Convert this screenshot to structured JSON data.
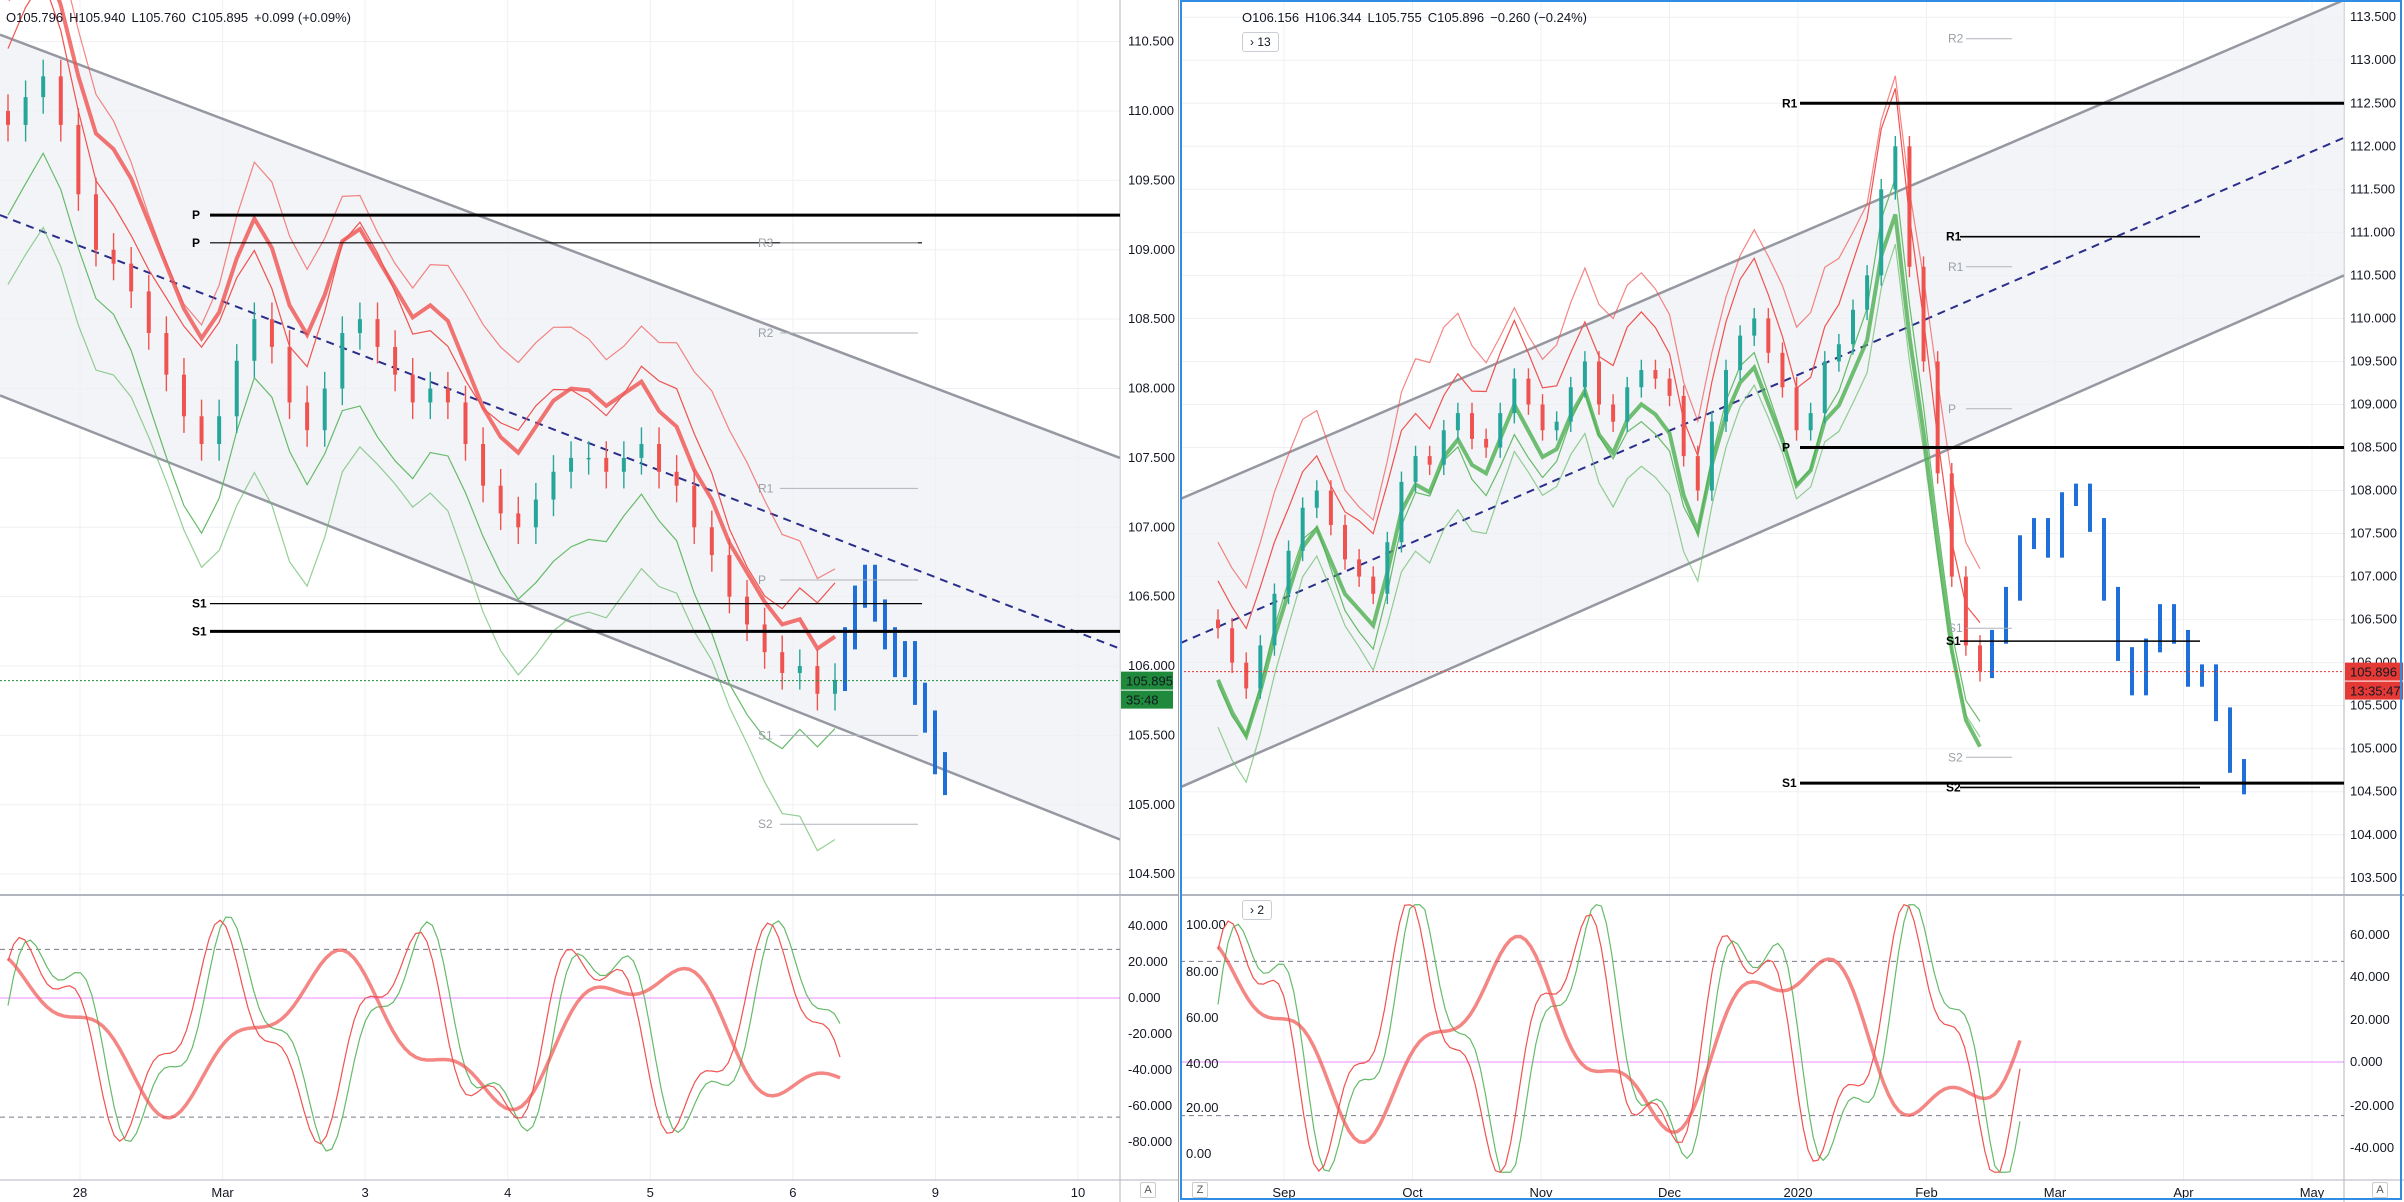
{
  "left": {
    "ohlc": {
      "o": "O105.796",
      "h": "H105.940",
      "l": "L105.760",
      "c": "C105.895",
      "chg": "+0.099 (+0.09%)"
    },
    "price_ticks": [
      "110.500",
      "110.000",
      "109.500",
      "109.000",
      "108.500",
      "108.000",
      "107.500",
      "107.000",
      "106.500",
      "106.000",
      "105.500",
      "105.000",
      "104.500"
    ],
    "time_ticks": [
      "28",
      "Mar",
      "3",
      "4",
      "5",
      "6",
      "9",
      "10"
    ],
    "osc_ticks": [
      "40.000",
      "20.000",
      "0.000",
      "-20.000",
      "-40.000",
      "-60.000",
      "-80.000"
    ],
    "current_price": "105.895",
    "countdown": "35:48",
    "levels_bold": [
      {
        "label": "P",
        "price": 109.25
      },
      {
        "label": "S1",
        "price": 106.25
      }
    ],
    "levels_thin": [
      {
        "label": "P",
        "price": 109.05
      },
      {
        "label": "S1",
        "price": 106.45
      }
    ],
    "levels_faint": [
      {
        "label": "R3",
        "price": 109.05
      },
      {
        "label": "R2",
        "price": 108.4
      },
      {
        "label": "R1",
        "price": 107.28
      },
      {
        "label": "P",
        "price": 106.62
      },
      {
        "label": "S1",
        "price": 105.5
      },
      {
        "label": "S2",
        "price": 104.86
      }
    ],
    "corner_label": "A",
    "color_up": "#26a69a",
    "color_down": "#ef5350"
  },
  "right": {
    "ohlc": {
      "o": "O106.156",
      "h": "H106.344",
      "l": "L105.755",
      "c": "C105.896",
      "chg": "−0.260 (−0.24%)"
    },
    "collapse_price": "13",
    "collapse_osc": "2",
    "price_ticks": [
      "113.500",
      "113.000",
      "112.500",
      "112.000",
      "111.500",
      "111.000",
      "110.500",
      "110.000",
      "109.500",
      "109.000",
      "108.500",
      "108.000",
      "107.500",
      "107.000",
      "106.500",
      "106.000",
      "105.500",
      "105.000",
      "104.500",
      "104.000",
      "103.500"
    ],
    "time_ticks": [
      "Sep",
      "Oct",
      "Nov",
      "Dec",
      "2020",
      "Feb",
      "Mar",
      "Apr",
      "May"
    ],
    "osc_left_ticks": [
      "100.00",
      "80.00",
      "60.00",
      "40.00",
      "20.00",
      "0.00"
    ],
    "osc_right_ticks": [
      "60.000",
      "40.000",
      "20.000",
      "0.000",
      "-20.000",
      "-40.000"
    ],
    "current_price": "105.896",
    "countdown": "13:35:47",
    "levels_bold": [
      {
        "label": "R1",
        "price": 112.5
      },
      {
        "label": "P",
        "price": 108.5
      },
      {
        "label": "S1",
        "price": 104.6
      }
    ],
    "levels_mid": [
      {
        "label": "R1",
        "price": 110.95
      },
      {
        "label": "S1",
        "price": 106.25
      },
      {
        "label": "S2",
        "price": 104.55
      }
    ],
    "levels_faint": [
      {
        "label": "R2",
        "price": 113.25
      },
      {
        "label": "R1",
        "price": 110.6
      },
      {
        "label": "P",
        "price": 108.95
      },
      {
        "label": "S1",
        "price": 106.4
      },
      {
        "label": "S2",
        "price": 104.9
      }
    ],
    "corner_z": "Z",
    "corner_a": "A"
  },
  "chart_data": [
    {
      "type": "candlestick",
      "title": "",
      "ohlc_last": {
        "open": 105.796,
        "high": 105.94,
        "low": 105.76,
        "close": 105.895
      },
      "x_ticks": [
        "28",
        "Mar",
        "3",
        "4",
        "5",
        "6",
        "9",
        "10"
      ],
      "ylim": [
        104.35,
        110.8
      ],
      "series": [
        {
          "name": "",
          "kind": "close-path",
          "values": [
            109.9,
            110.1,
            110.25,
            109.9,
            109.4,
            109.0,
            108.9,
            108.7,
            108.4,
            108.1,
            107.8,
            107.6,
            107.8,
            108.2,
            108.5,
            108.3,
            107.9,
            107.7,
            108.0,
            108.4,
            108.5,
            108.3,
            108.1,
            107.9,
            108.0,
            107.9,
            107.6,
            107.3,
            107.1,
            107.0,
            107.2,
            107.4,
            107.5,
            107.5,
            107.4,
            107.5,
            107.6,
            107.4,
            107.3,
            107.0,
            106.8,
            106.5,
            106.3,
            106.1,
            105.95,
            106.0,
            105.8,
            105.9
          ]
        },
        {
          "name": "",
          "kind": "forecast-blocks",
          "values": [
            106.2,
            106.5,
            106.65,
            106.4,
            106.2,
            106.0,
            106.1,
            105.8,
            105.6,
            105.3,
            105.15
          ]
        }
      ],
      "channel": {
        "upper_start": 110.55,
        "upper_end": 107.5,
        "lower_start": 107.95,
        "lower_end": 104.75
      },
      "oscillator": {
        "ylim": [
          -90,
          45
        ],
        "bands": [
          20,
          -60
        ],
        "zero": 0
      }
    },
    {
      "type": "candlestick",
      "title": "",
      "ohlc_last": {
        "open": 106.156,
        "high": 106.344,
        "low": 105.755,
        "close": 105.896
      },
      "x_ticks": [
        "Sep",
        "Oct",
        "Nov",
        "Dec",
        "2020",
        "Feb",
        "Mar",
        "Apr",
        "May"
      ],
      "ylim": [
        103.3,
        113.7
      ],
      "series": [
        {
          "name": "",
          "kind": "close-path",
          "values": [
            106.4,
            106.0,
            105.7,
            106.2,
            106.8,
            107.3,
            107.8,
            108.0,
            107.6,
            107.2,
            107.0,
            106.8,
            107.4,
            108.1,
            108.4,
            108.3,
            108.7,
            108.9,
            108.6,
            108.5,
            108.9,
            109.3,
            109.0,
            108.7,
            108.8,
            109.2,
            109.5,
            109.0,
            108.8,
            109.2,
            109.4,
            109.3,
            109.1,
            108.4,
            108.0,
            108.8,
            109.4,
            109.8,
            110.0,
            109.6,
            109.2,
            108.7,
            108.9,
            109.5,
            109.7,
            110.1,
            110.5,
            111.5,
            112.0,
            110.6,
            109.5,
            108.2,
            107.0,
            106.2,
            105.9
          ]
        },
        {
          "name": "",
          "kind": "forecast-blocks",
          "values": [
            106.3,
            106.8,
            107.4,
            107.6,
            107.3,
            107.9,
            108.0,
            107.6,
            106.8,
            106.1,
            105.7,
            106.2,
            106.6,
            106.3,
            105.8,
            105.9,
            105.4,
            104.8,
            104.55
          ]
        }
      ],
      "channel": {
        "upper_start": 107.9,
        "upper_end": 113.7,
        "lower_start": 104.55,
        "lower_end": 110.5
      },
      "oscillator": {
        "ylim": [
          -5,
          105
        ],
        "bands": [
          80,
          20
        ]
      }
    }
  ]
}
